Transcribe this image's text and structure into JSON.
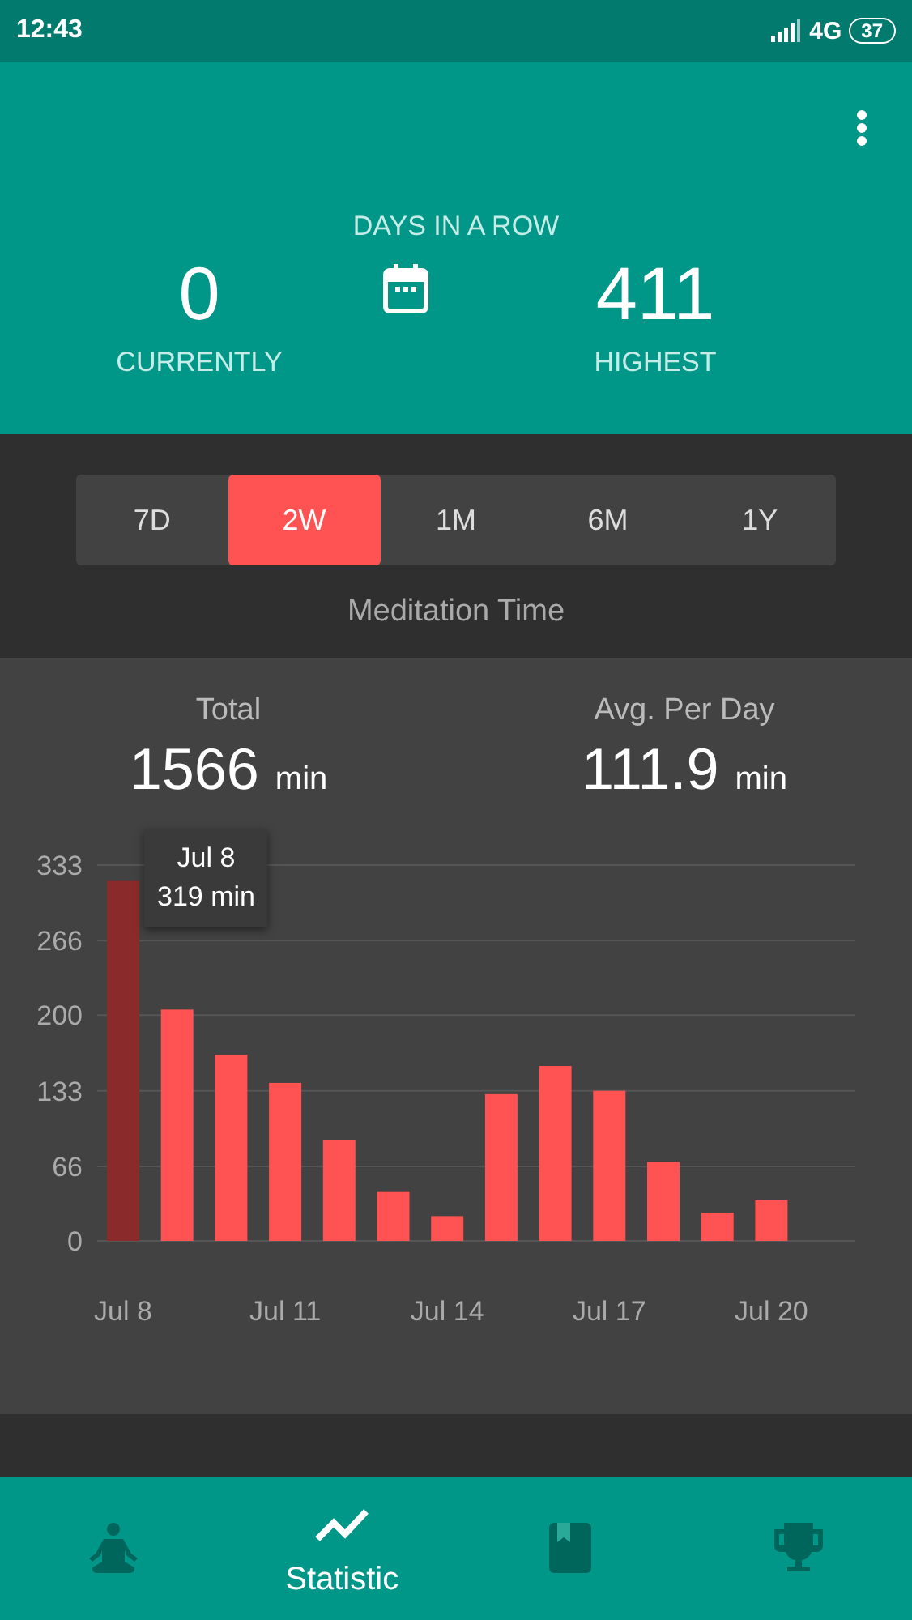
{
  "status_bar": {
    "time": "12:43",
    "network": "4G",
    "battery": "37"
  },
  "streak": {
    "title": "DAYS IN A ROW",
    "current": {
      "value": "0",
      "label": "CURRENTLY"
    },
    "highest": {
      "value": "411",
      "label": "HIGHEST"
    }
  },
  "ranges": [
    {
      "label": "7D",
      "selected": false
    },
    {
      "label": "2W",
      "selected": true
    },
    {
      "label": "1M",
      "selected": false
    },
    {
      "label": "6M",
      "selected": false
    },
    {
      "label": "1Y",
      "selected": false
    }
  ],
  "section_title": "Meditation Time",
  "summary": [
    {
      "label": "Total",
      "value": "1566",
      "unit": "min"
    },
    {
      "label": "Avg. Per Day",
      "value": "111.9",
      "unit": "min"
    }
  ],
  "chart_data": {
    "type": "bar",
    "categories": [
      "Jul 8",
      null,
      null,
      "Jul 11",
      null,
      null,
      "Jul 14",
      null,
      null,
      "Jul 17",
      null,
      null,
      "Jul 20"
    ],
    "series": [
      {
        "color": "#ff5252",
        "values": [
          null,
          205,
          165,
          140,
          89,
          44,
          22,
          130,
          155,
          133,
          70,
          25,
          36
        ]
      },
      {
        "color": "#8b2a2a",
        "values": [
          319,
          null,
          null,
          null,
          null,
          null,
          null,
          null,
          null,
          null,
          null,
          null,
          null
        ]
      }
    ],
    "yticks": [
      0,
      66,
      133,
      200,
      266,
      333
    ],
    "ylim": [
      0,
      333
    ],
    "grid": true
  },
  "tooltip": {
    "title": "Jul 8",
    "text": "319 min"
  },
  "bottom_nav": [
    {
      "selected": false
    },
    {
      "label": "Statistic",
      "selected": true
    },
    {
      "selected": false
    },
    {
      "selected": false
    }
  ]
}
